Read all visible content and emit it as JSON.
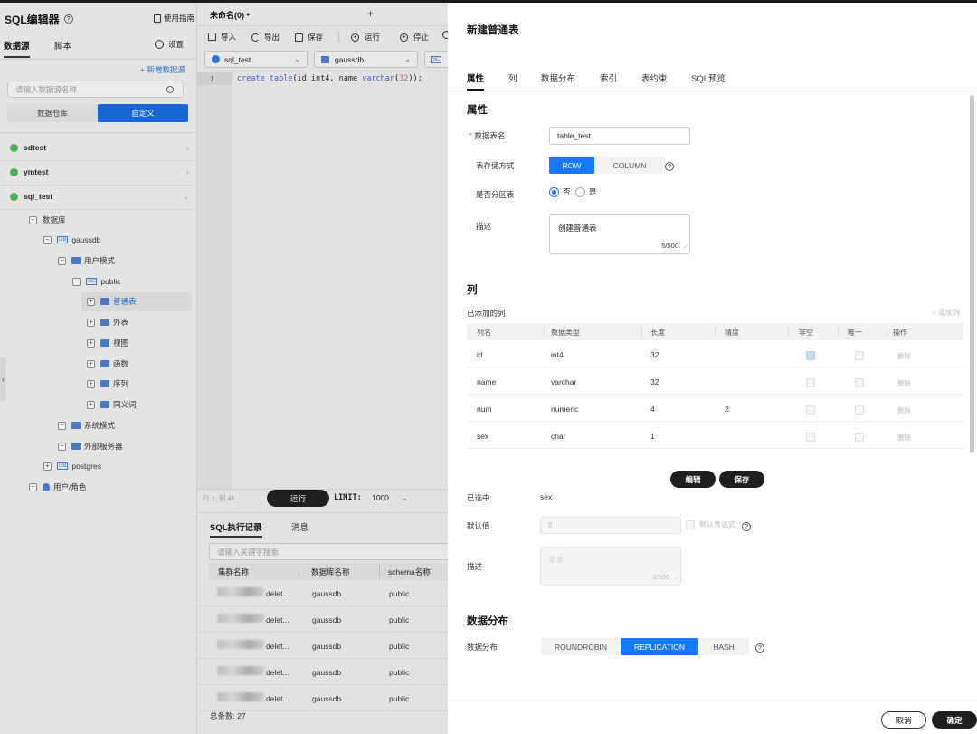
{
  "sidebar": {
    "title": "SQL编辑器",
    "guide": "使用指南",
    "tab_datasource": "数据源",
    "tab_script": "脚本",
    "settings": "设置",
    "add_datasource": "+ 新增数据源",
    "search_placeholder": "请输入数据源名称",
    "seg_warehouse": "数据仓库",
    "seg_custom": "自定义",
    "sources": [
      "sdtest",
      "ymtest",
      "sql_test"
    ],
    "tree": {
      "database": "数据库",
      "gaussdb": "gaussdb",
      "user_schema": "用户模式",
      "public": "public",
      "tables": "普通表",
      "foreign": "外表",
      "views": "视图",
      "functions": "函数",
      "sequences": "序列",
      "synonyms": "同义词",
      "system_schema": "系统模式",
      "external_server": "外部服务器",
      "postgres": "postgres",
      "users_roles": "用户/角色"
    }
  },
  "editor": {
    "tab_title": "未命名(0)",
    "tab_dot": "●",
    "add_tab": "+",
    "toolbar": {
      "import": "导入",
      "export": "导出",
      "save": "保存",
      "run": "运行",
      "stop": "停止"
    },
    "select_source": "sql_test",
    "select_db": "gaussdb",
    "line_no": "1",
    "code": {
      "kw1": "create",
      "kw2": "table",
      "rest1": "(id int4, name ",
      "kw3": "varchar",
      "num": "32",
      "rest2": "));"
    },
    "cursor_pos": "行 1, 列 41",
    "run_button": "运行",
    "limit_label": "LIMIT:",
    "limit_value": "1000",
    "history_tab": "SQL执行记录",
    "message_tab": "消息",
    "history_search_placeholder": "请输入关键字搜索",
    "history_headers": [
      "集群名称",
      "数据库名称",
      "schema名称"
    ],
    "history_rows": [
      {
        "op": "delet...",
        "db": "gaussdb",
        "schema": "public"
      },
      {
        "op": "delet...",
        "db": "gaussdb",
        "schema": "public"
      },
      {
        "op": "delet...",
        "db": "gaussdb",
        "schema": "public"
      },
      {
        "op": "delet...",
        "db": "gaussdb",
        "schema": "public"
      },
      {
        "op": "delet...",
        "db": "gaussdb",
        "schema": "public"
      }
    ],
    "total": "总条数: 27"
  },
  "drawer": {
    "title": "新建普通表",
    "tabs": [
      "属性",
      "列",
      "数据分布",
      "索引",
      "表约束",
      "SQL预览"
    ],
    "attr_section": "属性",
    "table_name_label": "数据表名",
    "table_name_value": "table_test",
    "storage_label": "表存储方式",
    "storage_row": "ROW",
    "storage_column": "COLUMN",
    "partition_label": "是否分区表",
    "partition_no": "否",
    "partition_yes": "是",
    "desc_label": "描述",
    "desc_value": "创建普通表",
    "desc_count": "5/500",
    "col_section": "列",
    "added_cols": "已添加的列",
    "add_col": "+ 添加列",
    "col_headers": [
      "列名",
      "数据类型",
      "长度",
      "精度",
      "非空",
      "唯一",
      "操作"
    ],
    "columns": [
      {
        "name": "id",
        "type": "int4",
        "length": "32",
        "precision": "",
        "del": "删除"
      },
      {
        "name": "name",
        "type": "varchar",
        "length": "32",
        "precision": "",
        "del": "删除"
      },
      {
        "name": "num",
        "type": "numeric",
        "length": "4",
        "precision": "2",
        "del": "删除"
      },
      {
        "name": "sex",
        "type": "char",
        "length": "1",
        "precision": "",
        "del": "删除"
      }
    ],
    "edit_button": "编辑",
    "save_button": "保存",
    "selected_label": "已选中:",
    "selected_value": "sex",
    "default_label": "默认值",
    "default_value": "8",
    "default_expr": "默认表达式",
    "col_desc_label": "描述",
    "col_desc_placeholder": "信息",
    "col_desc_count": "2/500",
    "dist_section": "数据分布",
    "dist_label": "数据分布",
    "dist_options": [
      "ROUNDROBIN",
      "REPLICATION",
      "HASH"
    ],
    "cancel_button": "取消",
    "confirm_button": "确定"
  },
  "colors": {
    "primary": "#1677ff",
    "dark": "#1f1f1f",
    "keyword": "#3a5bc7",
    "number": "#b5538a"
  }
}
